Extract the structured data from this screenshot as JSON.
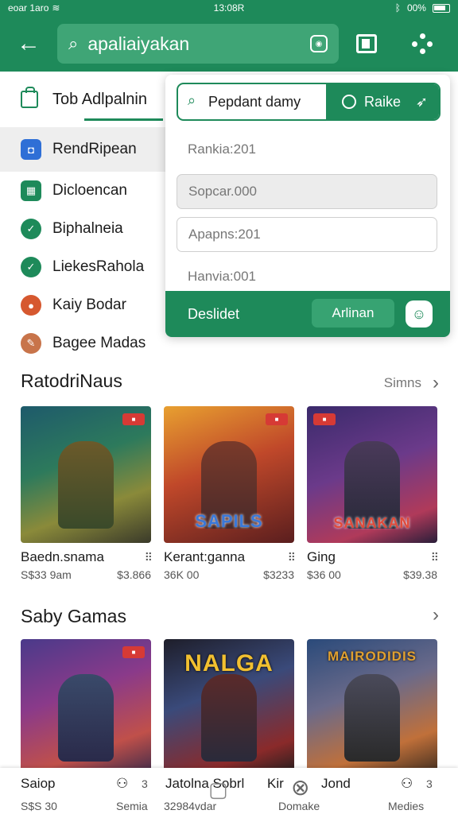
{
  "status": {
    "left": "eoar 1aro",
    "time": "13:08R",
    "battery": "00%"
  },
  "appbar": {
    "search_query": "apaliaiyakan"
  },
  "sidebar": {
    "tab_label": "Tob Adlpalnin",
    "items": [
      {
        "label": "RendRipean",
        "color": "#2f6fd6"
      },
      {
        "label": "Dicloencan",
        "color": "#1e8a5a"
      },
      {
        "label": "Biphalneia",
        "color": "#1e8a5a"
      },
      {
        "label": "LiekesRahola",
        "color": "#1e8a5a"
      },
      {
        "label": "Kaiy Bodar",
        "color": "#d6582f"
      },
      {
        "label": "Bagee Madas",
        "color": "#c8744a"
      }
    ]
  },
  "dropdown": {
    "search_text": "Pepdant damy",
    "go_label": "Raike",
    "rows": [
      "Rankia:201",
      "Sopcar.000",
      "Apapns:201",
      "Hanvia:001"
    ],
    "footer_label": "Deslidet",
    "footer_button": "Arlinan"
  },
  "section1": {
    "title": "RatodriNaus",
    "more": "Simns",
    "cards": [
      {
        "name": "Baedn.snama",
        "price": "S$33 9am",
        "alt": "$3.866",
        "logo": "",
        "badge": ""
      },
      {
        "name": "Kerant:ganna",
        "price": "36K 00",
        "alt": "$3233",
        "logo": "SAPILS",
        "badge": ""
      },
      {
        "name": "Ging",
        "price": "$36 00",
        "alt": "$39.38",
        "logo": "SANAKAN",
        "badge": ""
      }
    ]
  },
  "section2": {
    "title": "Saby Gamas",
    "cards": [
      {
        "name": "Saiop",
        "price": "S$S 30",
        "logo": ""
      },
      {
        "name": "",
        "price": "",
        "logo": "NALGA"
      },
      {
        "name": "",
        "price": "",
        "logo": "MAIRODIDIS"
      }
    ]
  },
  "bottomnav": {
    "items": [
      {
        "label": "Semia",
        "count": "3"
      },
      {
        "label": "Jatolna Sobrl",
        "sub": "32984vdar"
      },
      {
        "label": "Kir",
        "sub": "Domake"
      },
      {
        "label": "Jond",
        "sub": ""
      },
      {
        "label": "Medies",
        "count": "3"
      }
    ]
  },
  "colors": {
    "brand": "#1e8a5a",
    "accent_red": "#d63a35"
  }
}
